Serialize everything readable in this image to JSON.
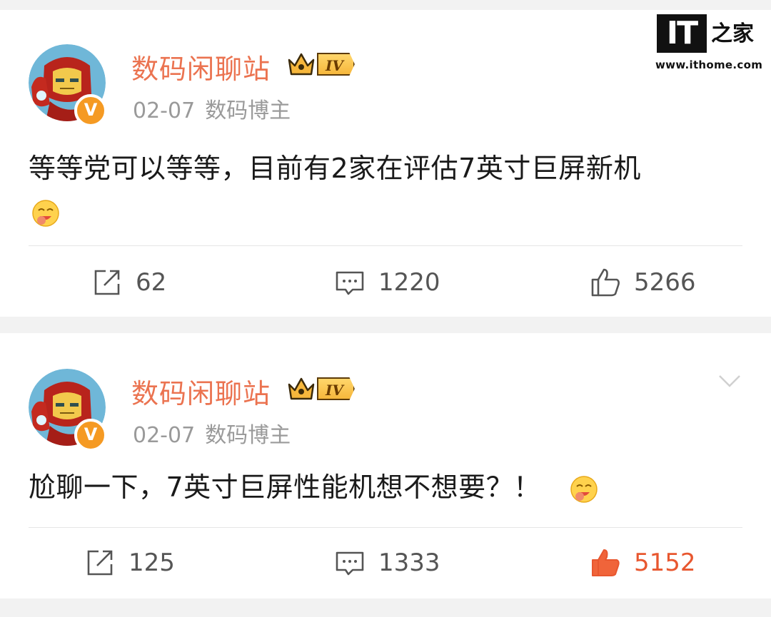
{
  "posts": [
    {
      "username": "数码闲聊站",
      "level_badge": "IV",
      "verified_mark": "V",
      "date": "02-07",
      "source": "数码博主",
      "text": "等等党可以等等，目前有2家在评估7英寸巨屏新机",
      "emoji": "yummy-face-icon",
      "shares": "62",
      "comments": "1220",
      "likes": "5266",
      "liked": false
    },
    {
      "username": "数码闲聊站",
      "level_badge": "IV",
      "verified_mark": "V",
      "date": "02-07",
      "source": "数码博主",
      "text": "尬聊一下，7英寸巨屏性能机想不想要？！",
      "emoji": "yummy-face-icon",
      "shares": "125",
      "comments": "1333",
      "likes": "5152",
      "liked": true
    }
  ],
  "watermark": {
    "logo_text": "IT",
    "logo_char": "之家",
    "url": "www.ithome.com"
  },
  "colors": {
    "username": "#eb7350",
    "meta": "#9a9a9a",
    "liked": "#e8572f",
    "background": "#f2f2f2"
  }
}
